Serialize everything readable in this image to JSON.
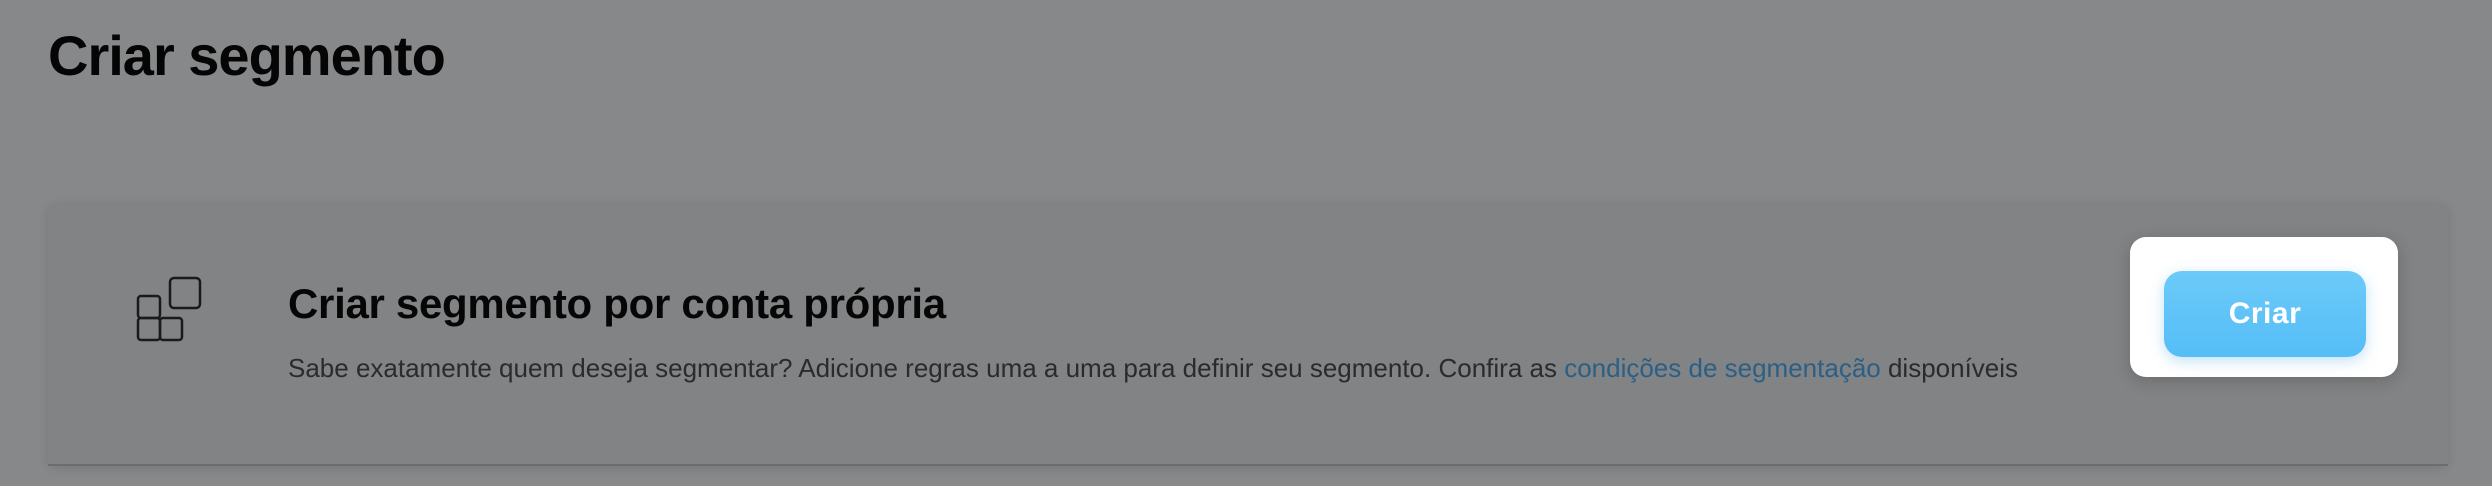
{
  "page": {
    "title": "Criar segmento"
  },
  "option": {
    "icon": "grid-blocks-icon",
    "title": "Criar segmento por conta própria",
    "description_before": "Sabe exatamente quem deseja segmentar? Adicione regras uma a uma para definir seu segmento. Confira as ",
    "link_text": "condições de segmentação",
    "description_after": " disponíveis",
    "button_label": "Criar"
  },
  "colors": {
    "background": "#878889",
    "link": "#2b5f86",
    "button": "#5cc1f7"
  }
}
